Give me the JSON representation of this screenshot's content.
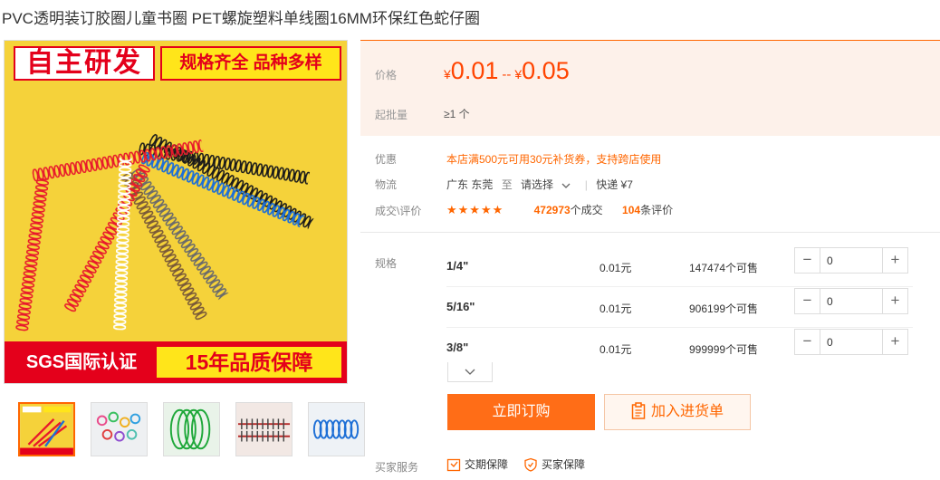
{
  "product": {
    "title": "PVC透明装订胶圈儿童书圈 PET螺旋塑料单线圈16MM环保红色蛇仔圈"
  },
  "image": {
    "banner_left": "自主研发",
    "banner_right": "规格齐全 品种多样",
    "footer_left": "SGS国际认证",
    "footer_right": "15年品质保障"
  },
  "price": {
    "label": "价格",
    "currency": "¥",
    "low": "0.01",
    "separator": "--",
    "high": "0.05"
  },
  "moq": {
    "label": "起批量",
    "value": "≥1 个"
  },
  "promo": {
    "label": "优惠",
    "text": "本店满500元可用30元补货券，支持跨店使用"
  },
  "logistics": {
    "label": "物流",
    "origin": "广东 东莞",
    "to": "至",
    "destination": "请选择",
    "method": "快递 ¥7"
  },
  "reviews": {
    "label": "成交\\评价",
    "stars": "★★★★★",
    "orders": "472973",
    "orders_suffix": "个成交",
    "count": "104",
    "count_suffix": "条评价"
  },
  "sku": {
    "label": "规格",
    "rows": [
      {
        "name": "1/4\"",
        "price": "0.01元",
        "stock": "147474个可售",
        "qty": "0"
      },
      {
        "name": "5/16\"",
        "price": "0.01元",
        "stock": "906199个可售",
        "qty": "0"
      },
      {
        "name": "3/8\"",
        "price": "0.01元",
        "stock": "999999个可售",
        "qty": "0"
      }
    ]
  },
  "actions": {
    "order": "立即订购",
    "cart": "加入进货单"
  },
  "service": {
    "label": "买家服务",
    "items": [
      "交期保障",
      "买家保障"
    ]
  },
  "colors": {
    "accent": "#ff6d17",
    "price": "#ff4400",
    "price_bg": "#fdf1ea"
  }
}
